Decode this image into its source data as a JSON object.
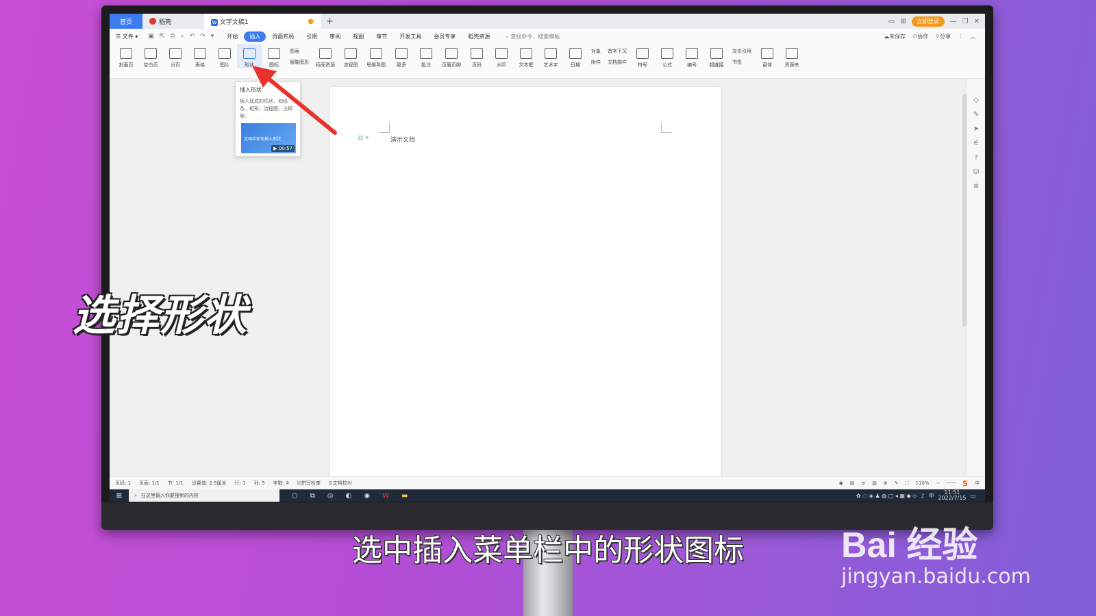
{
  "titlebar": {
    "tabs": [
      {
        "label": "首页"
      },
      {
        "label": "稻壳"
      },
      {
        "label": "文字文稿1"
      }
    ],
    "login_button": "立即登录"
  },
  "menubar": {
    "file": "文件",
    "items": [
      "开始",
      "插入",
      "页面布局",
      "引用",
      "审阅",
      "视图",
      "章节",
      "开发工具",
      "会员专享",
      "稻壳资源"
    ],
    "active": "插入",
    "search_placeholder": "查找命令、搜索模板",
    "right": [
      "未保存",
      "协作",
      "分享"
    ]
  },
  "ribbon": {
    "buttons": [
      "封面页",
      "空白页",
      "分页",
      "表格",
      "图片",
      "形状",
      "图标"
    ],
    "stack1": [
      "图表",
      "智能图形"
    ],
    "buttons2": [
      "稻壳资源",
      "流程图",
      "思维导图",
      "更多",
      "批注",
      "页眉页脚",
      "页码",
      "水印",
      "文本框",
      "艺术字",
      "日期"
    ],
    "stack2": [
      "对象",
      "附件"
    ],
    "stack3": [
      "首字下沉",
      "文档部件"
    ],
    "buttons3": [
      "符号",
      "公式",
      "编号",
      "超链接"
    ],
    "stack4": [
      "交叉引用",
      "书签"
    ],
    "buttons4": [
      "窗体",
      "资源夹"
    ]
  },
  "tooltip": {
    "title": "插入形状",
    "description": "插入现成的形状，如线条、矩形、流程图、注释等。",
    "video_title": "文档中如何插入形状",
    "video_duration": "00:57"
  },
  "document": {
    "text": "演示文档"
  },
  "statusbar": {
    "items": [
      "页码: 1",
      "页面: 1/1",
      "节: 1/1",
      "设置值: 2.5厘米",
      "行: 1",
      "列: 5",
      "字数: 4",
      "拼写检查",
      "文档校对"
    ],
    "zoom": "110%"
  },
  "taskbar": {
    "search_placeholder": "在这里输入你要搜索的内容",
    "time": "11:51",
    "date": "2022/7/15",
    "ime": "中"
  },
  "overlay": {
    "big_caption": "选择形状",
    "subtitle": "选中插入菜单栏中的形状图标"
  },
  "watermark": {
    "brand": "Bai 经验",
    "url": "jingyan.baidu.com"
  },
  "colors": {
    "accent": "#3d7bf0",
    "arrow": "#e8322c",
    "background_start": "#c94fd6",
    "background_end": "#7f5ed8"
  }
}
